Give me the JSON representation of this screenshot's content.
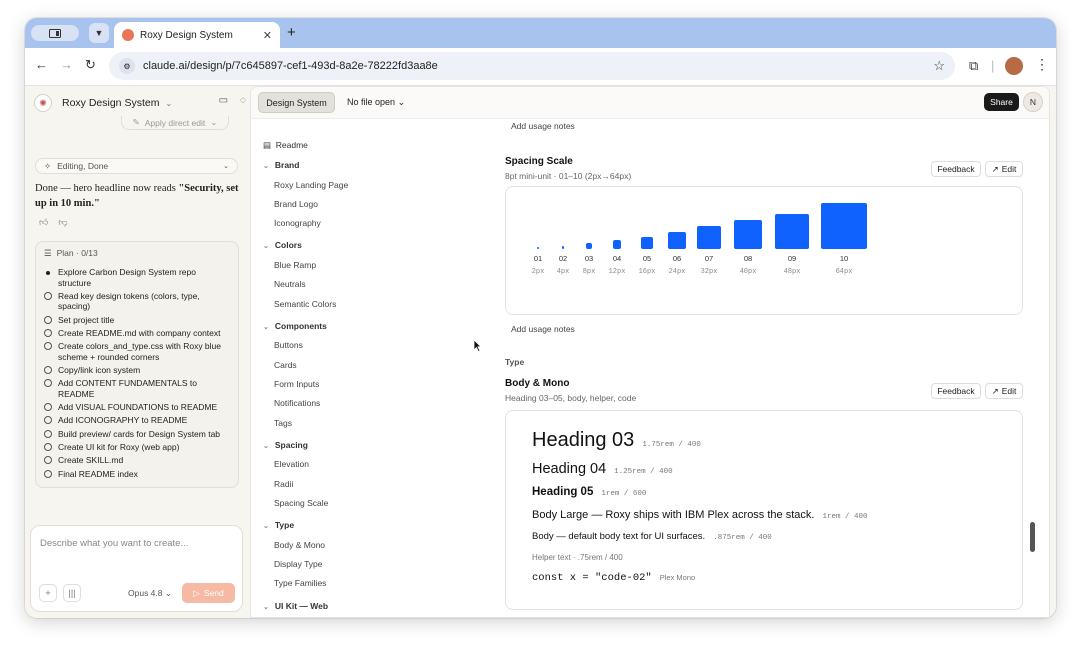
{
  "browser": {
    "tab_title": "Roxy Design System",
    "new_tab_label": "+",
    "url": "claude.ai/design/p/7c645897-cef1-493d-8a2e-78222fd3aa8e"
  },
  "left_pane": {
    "project_name": "Roxy Design System",
    "apply_edit_label": "Apply direct edit",
    "status_label": "Editing, Done",
    "message_prefix": "Done — hero headline now reads ",
    "message_bold": "\"Security, set up in 10 min.\"",
    "plan_title": "Plan · 0/13",
    "plan_items": [
      "Explore Carbon Design System repo structure",
      "Read key design tokens (colors, type, spacing)",
      "Set project title",
      "Create README.md with company context",
      "Create colors_and_type.css with Roxy blue scheme + rounded corners",
      "Copy/link icon system",
      "Add CONTENT FUNDAMENTALS to README",
      "Add VISUAL FOUNDATIONS to README",
      "Add ICONOGRAPHY to README",
      "Build preview/ cards for Design System tab",
      "Create UI kit for Roxy (web app)",
      "Create SKILL.md",
      "Final README index"
    ],
    "composer_placeholder": "Describe what you want to create...",
    "model_label": "Opus 4.8",
    "send_label": "Send"
  },
  "toolbar": {
    "design_system_label": "Design System",
    "file_label": "No file open",
    "share_label": "Share",
    "avatar_initial": "N"
  },
  "sidenav": {
    "readme": "Readme",
    "sections": [
      {
        "title": "Brand",
        "items": [
          "Roxy Landing Page",
          "Brand Logo",
          "Iconography"
        ]
      },
      {
        "title": "Colors",
        "items": [
          "Blue Ramp",
          "Neutrals",
          "Semantic Colors"
        ]
      },
      {
        "title": "Components",
        "items": [
          "Buttons",
          "Cards",
          "Form Inputs",
          "Notifications",
          "Tags"
        ]
      },
      {
        "title": "Spacing",
        "items": [
          "Elevation",
          "Radii",
          "Spacing Scale"
        ]
      },
      {
        "title": "Type",
        "items": [
          "Body & Mono",
          "Display Type",
          "Type Families"
        ]
      },
      {
        "title": "UI Kit — Web",
        "items": []
      }
    ]
  },
  "content": {
    "usage_notes_label": "Add usage notes",
    "feedback_label": "Feedback",
    "edit_label": "Edit",
    "spacing": {
      "title": "Spacing Scale",
      "subtitle": "8pt mini-unit · 01–10 (2px→64px)",
      "steps": [
        {
          "num": "01",
          "px": "2px",
          "value": 2
        },
        {
          "num": "02",
          "px": "4px",
          "value": 4
        },
        {
          "num": "03",
          "px": "8px",
          "value": 8
        },
        {
          "num": "04",
          "px": "12px",
          "value": 12
        },
        {
          "num": "05",
          "px": "16px",
          "value": 16
        },
        {
          "num": "06",
          "px": "24px",
          "value": 24
        },
        {
          "num": "07",
          "px": "32px",
          "value": 32
        },
        {
          "num": "08",
          "px": "40px",
          "value": 40
        },
        {
          "num": "09",
          "px": "48px",
          "value": 48
        },
        {
          "num": "10",
          "px": "64px",
          "value": 64
        }
      ]
    },
    "type_label": "Type",
    "body_mono": {
      "title": "Body & Mono",
      "subtitle": "Heading 03–05, body, helper, code",
      "h03": "Heading 03",
      "h03_meta": "1.75rem / 400",
      "h04": "Heading 04",
      "h04_meta": "1.25rem / 400",
      "h05": "Heading 05",
      "h05_meta": "1rem / 600",
      "body_large": "Body Large — Roxy ships with IBM Plex across the stack.",
      "body_large_meta": "1rem / 400",
      "body": "Body — default body text for UI surfaces.",
      "body_meta": ".875rem / 400",
      "helper": "Helper text · .75rem / 400",
      "code": "const x = \"code-02\"",
      "code_meta": "Plex Mono"
    }
  },
  "colors": {
    "accent": "#0f62fe",
    "send": "#f6b9a4"
  }
}
